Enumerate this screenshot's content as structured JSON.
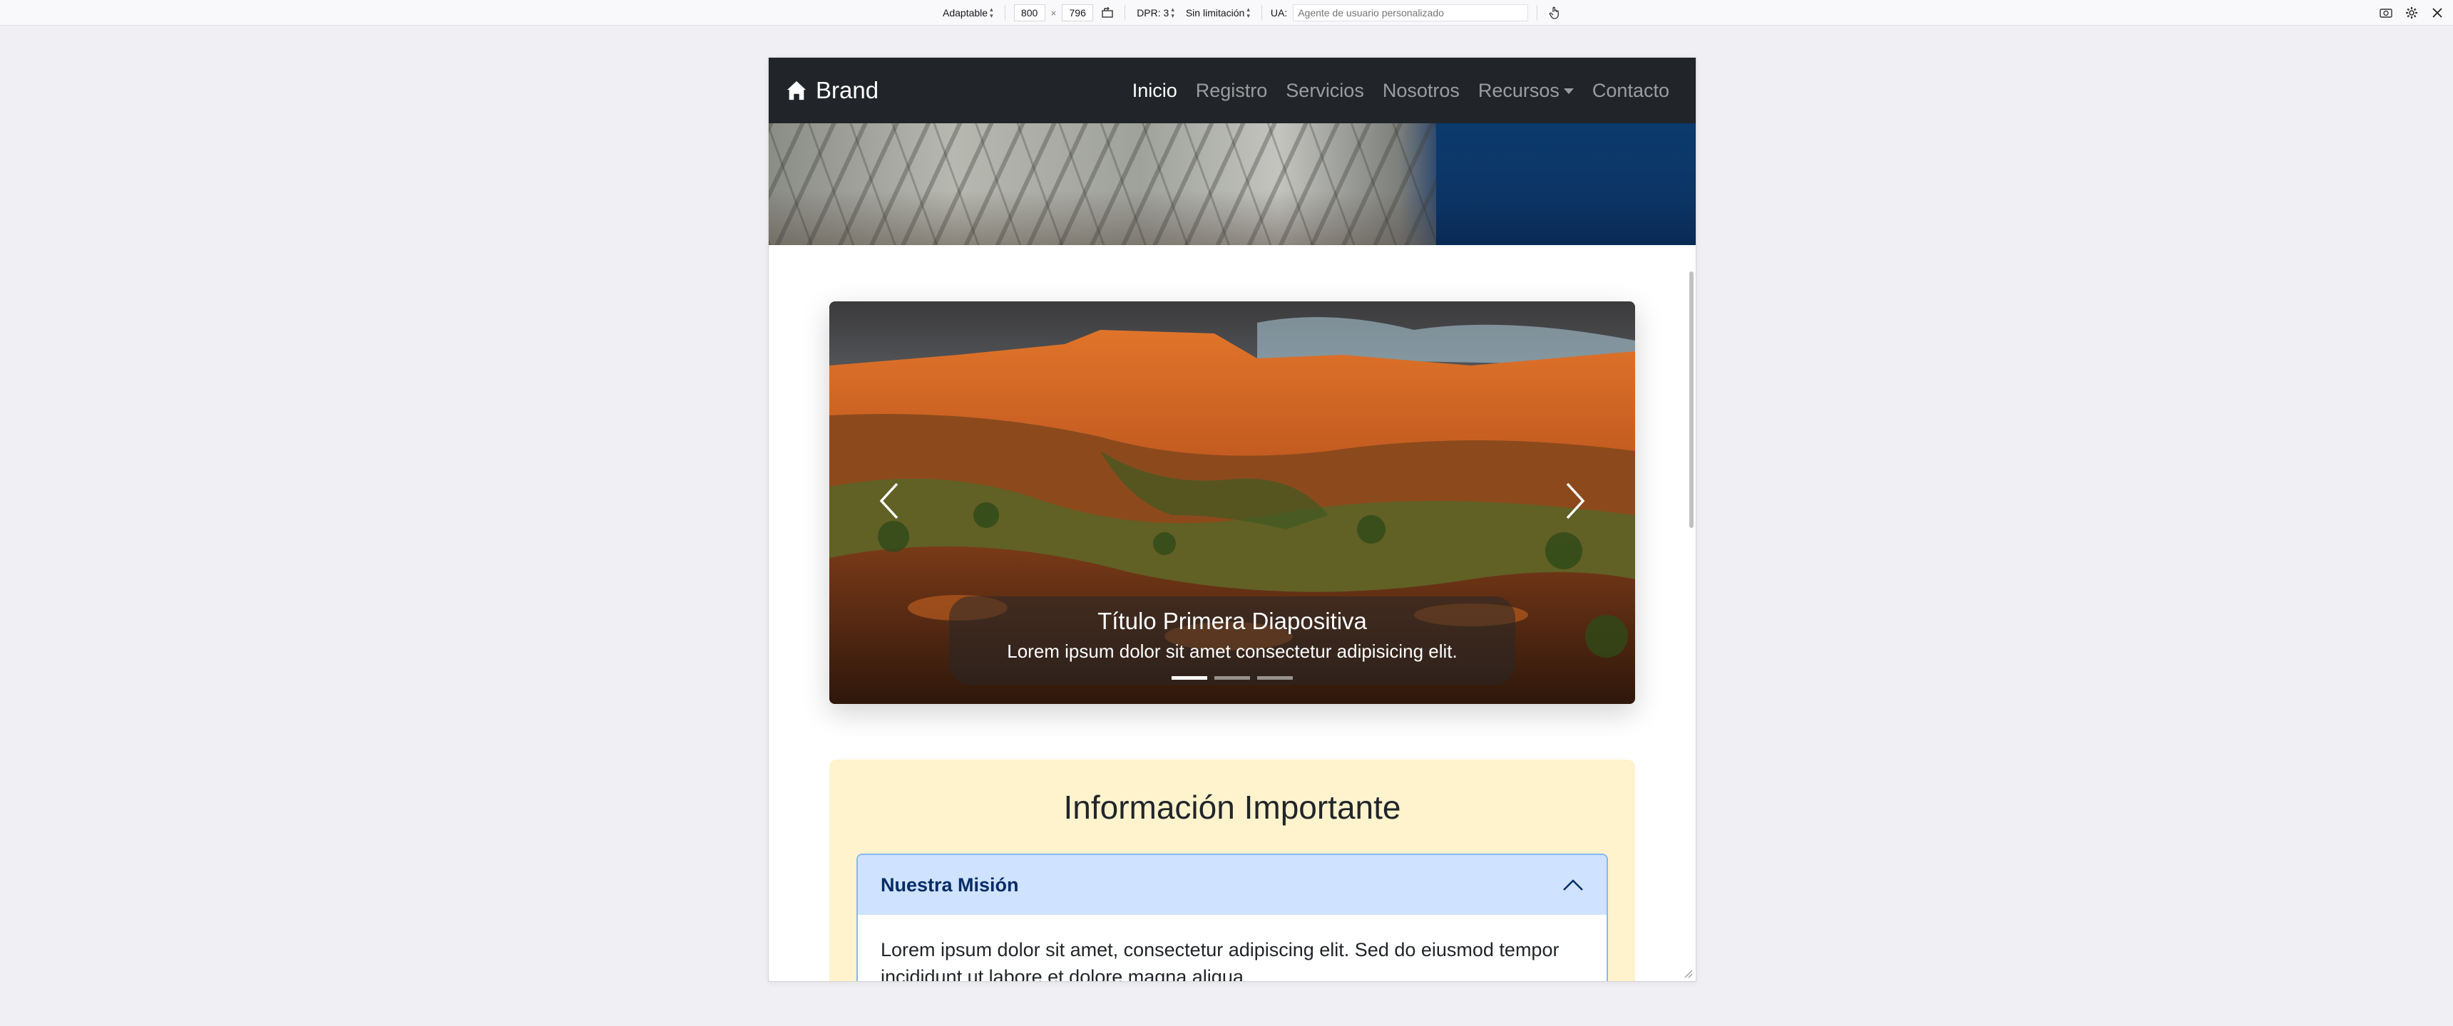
{
  "toolbar": {
    "device_mode": "Adaptable",
    "width": "800",
    "times": "×",
    "height": "796",
    "dpr": "DPR: 3",
    "throttling": "Sin limitación",
    "ua_label": "UA:",
    "ua_placeholder": "Agente de usuario personalizado"
  },
  "navbar": {
    "brand": "Brand",
    "links": [
      {
        "label": "Inicio",
        "active": true
      },
      {
        "label": "Registro"
      },
      {
        "label": "Servicios"
      },
      {
        "label": "Nosotros"
      },
      {
        "label": "Recursos",
        "dropdown": true
      },
      {
        "label": "Contacto"
      }
    ]
  },
  "carousel": {
    "slide_title": "Título Primera Diapositiva",
    "slide_text": "Lorem ipsum dolor sit amet consectetur adipisicing elit.",
    "active_index": 0,
    "slide_count": 3
  },
  "info": {
    "title": "Información Importante",
    "accordion": {
      "header": "Nuestra Misión",
      "body": "Lorem ipsum dolor sit amet, consectetur adipiscing elit. Sed do eiusmod tempor incididunt ut labore et dolore magna aliqua."
    }
  },
  "colors": {
    "navbar_bg": "#212529",
    "info_bg": "#fff3cd",
    "accordion_header_bg": "#cfe2ff",
    "accordion_header_text": "#052c65"
  }
}
